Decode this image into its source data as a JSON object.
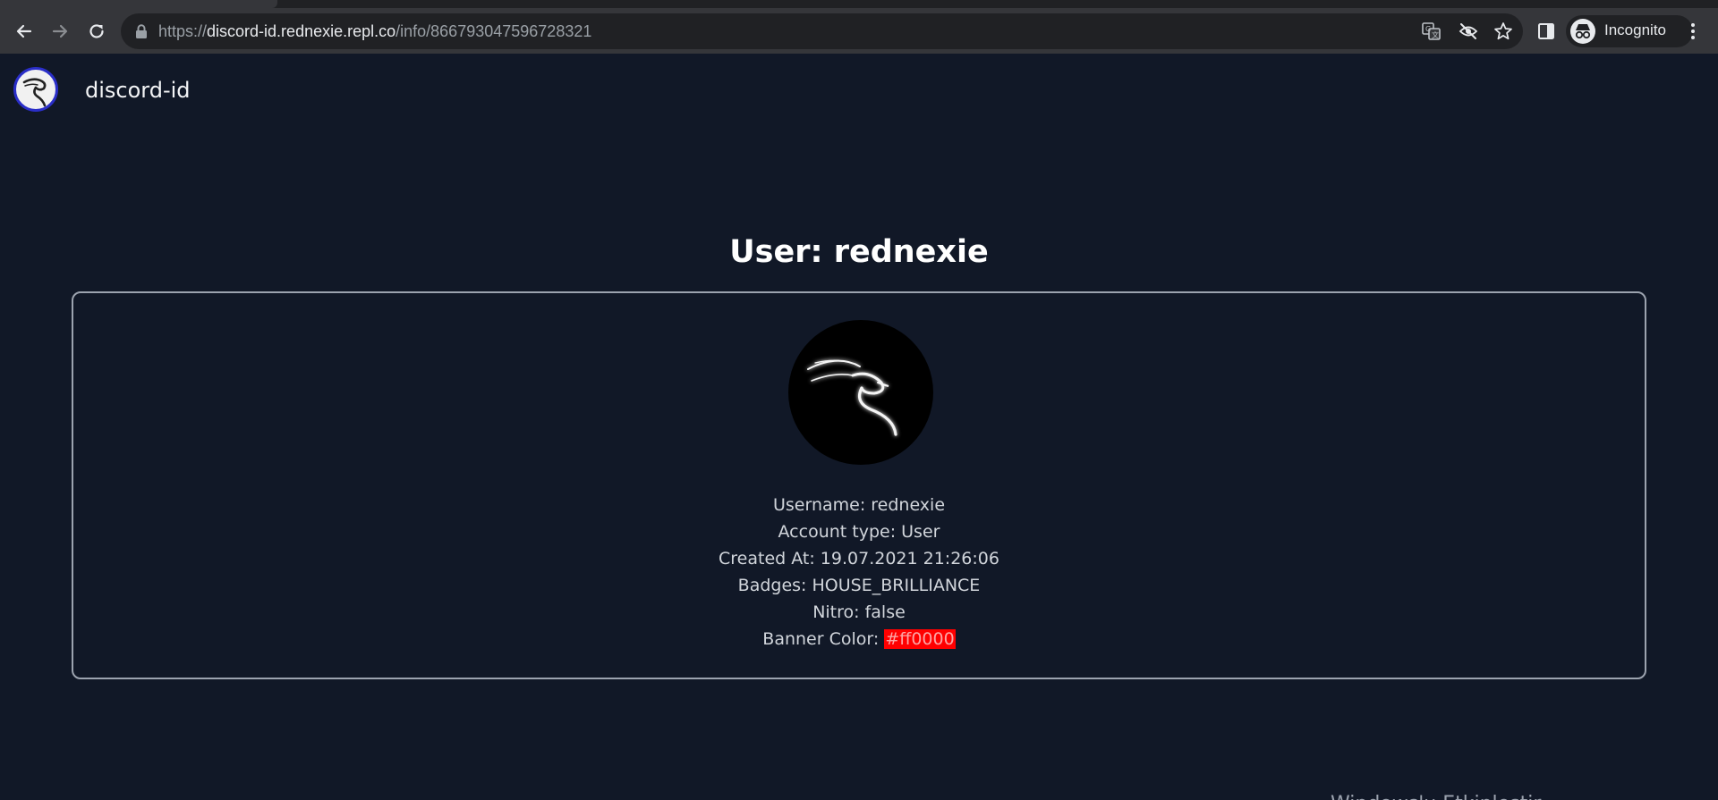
{
  "browser": {
    "url_scheme": "https://",
    "url_host": "discord-id.rednexie.repl.co",
    "url_path": "/info/866793047596728321",
    "profile_label": "Incognito",
    "icons": [
      "back-icon",
      "forward-icon",
      "reload-icon",
      "lock-icon",
      "translate-icon",
      "eye-off-icon",
      "star-icon",
      "side-panel-icon",
      "incognito-icon",
      "menu-icon"
    ]
  },
  "site": {
    "name": "discord-id"
  },
  "user": {
    "title": "User: rednexie",
    "username": "Username: rednexie",
    "account_type": "Account type: User",
    "created_at": "Created At: 19.07.2021 21:26:06",
    "badges": "Badges: HOUSE_BRILLIANCE",
    "nitro": "Nitro: false",
    "banner_label": "Banner Color: ",
    "banner_color": "#ff0000"
  },
  "footer": {
    "text": "Windows'u Etkinleştir"
  },
  "colors": {
    "background": "#111827",
    "banner": "#ff0000",
    "card_border": "#9ca3af"
  }
}
